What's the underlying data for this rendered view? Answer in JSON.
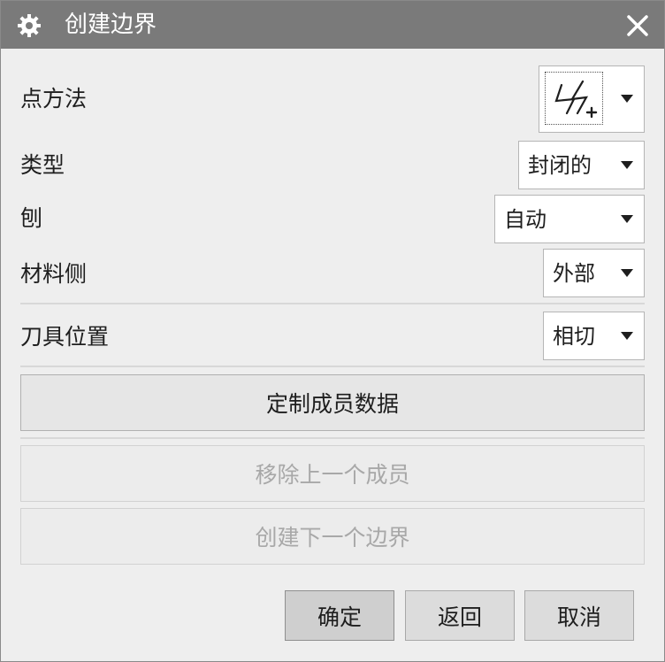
{
  "window": {
    "title": "创建边界",
    "title_icon": "gear-icon",
    "close_icon": "close-icon"
  },
  "rows": {
    "point_method": {
      "label": "点方法",
      "icon": "point-constructor-icon"
    },
    "type": {
      "label": "类型",
      "value": "封闭的"
    },
    "plane": {
      "label": "刨",
      "value": "自动"
    },
    "material_side": {
      "label": "材料侧",
      "value": "外部"
    },
    "tool_position": {
      "label": "刀具位置",
      "value": "相切"
    }
  },
  "buttons": {
    "custom_member_data": "定制成员数据",
    "remove_last_member": "移除上一个成员",
    "create_next_boundary": "创建下一个边界",
    "ok": "确定",
    "back": "返回",
    "cancel": "取消"
  },
  "colors": {
    "titlebar": "#7a7a7a",
    "dialog_bg": "#eeeeee",
    "disabled_text": "#a8a8a8"
  }
}
